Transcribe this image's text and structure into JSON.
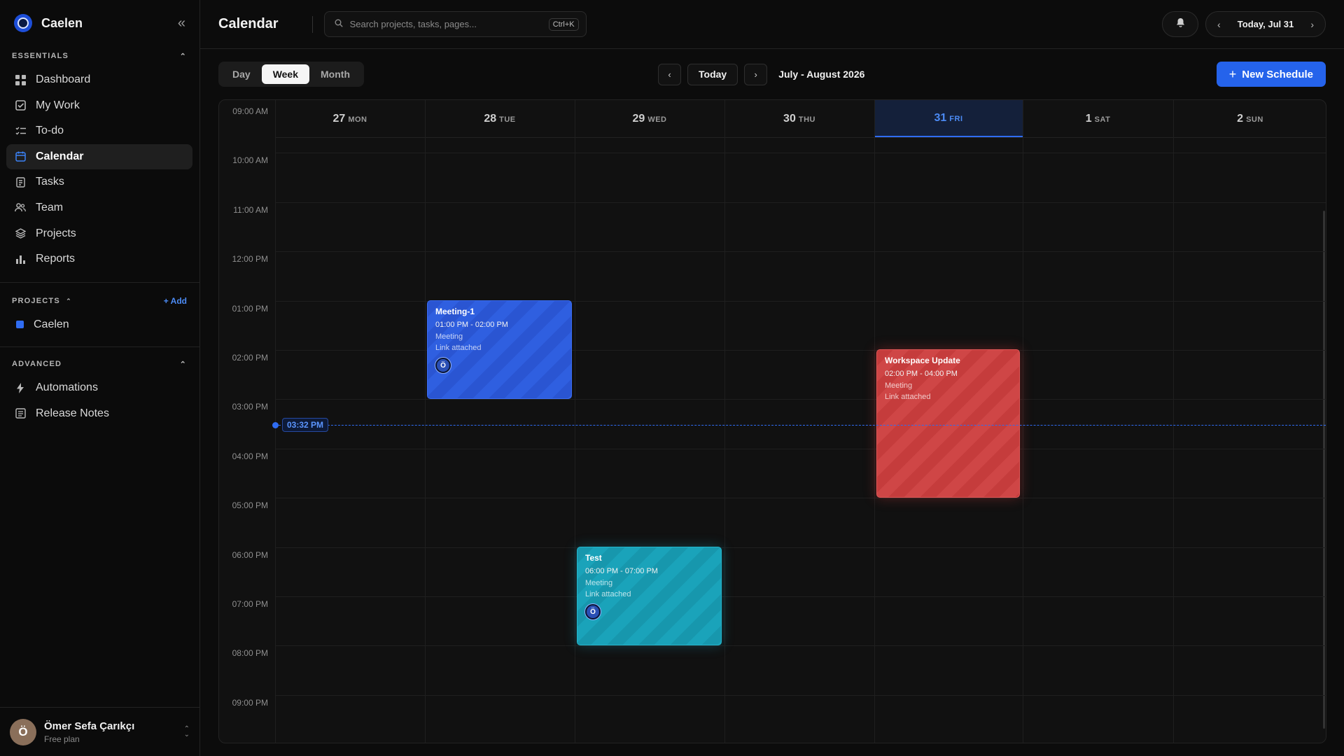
{
  "brand": {
    "name": "Caelen"
  },
  "sidebar": {
    "essentials_label": "ESSENTIALS",
    "items": [
      {
        "label": "Dashboard",
        "icon": "grid-icon"
      },
      {
        "label": "My Work",
        "icon": "checkbox-icon"
      },
      {
        "label": "To-do",
        "icon": "checklist-icon"
      },
      {
        "label": "Calendar",
        "icon": "calendar-icon",
        "active": true
      },
      {
        "label": "Tasks",
        "icon": "clipboard-icon"
      },
      {
        "label": "Team",
        "icon": "users-icon"
      },
      {
        "label": "Projects",
        "icon": "layers-icon"
      },
      {
        "label": "Reports",
        "icon": "bar-chart-icon"
      }
    ],
    "projects_label": "PROJECTS",
    "add_label": "+ Add",
    "projects": [
      {
        "label": "Caelen",
        "color": "#2f6cf2"
      }
    ],
    "advanced_label": "ADVANCED",
    "advanced_items": [
      {
        "label": "Automations",
        "icon": "bolt-icon"
      },
      {
        "label": "Release Notes",
        "icon": "notes-icon"
      }
    ]
  },
  "user": {
    "initial": "Ö",
    "name": "Ömer Sefa Çarıkçı",
    "plan": "Free plan"
  },
  "header": {
    "title": "Calendar",
    "search_placeholder": "Search projects, tasks, pages...",
    "search_shortcut": "Ctrl+K",
    "date_label": "Today, Jul 31"
  },
  "toolbar": {
    "views": [
      "Day",
      "Week",
      "Month"
    ],
    "active_view": "Week",
    "today_label": "Today",
    "range_label": "July - August 2026",
    "new_button": "New Schedule"
  },
  "calendar": {
    "days": [
      {
        "num": "27",
        "wd": "MON"
      },
      {
        "num": "28",
        "wd": "TUE"
      },
      {
        "num": "29",
        "wd": "WED"
      },
      {
        "num": "30",
        "wd": "THU"
      },
      {
        "num": "31",
        "wd": "FRI",
        "today": true
      },
      {
        "num": "1",
        "wd": "SAT"
      },
      {
        "num": "2",
        "wd": "SUN"
      }
    ],
    "hours": [
      "09:00 AM",
      "10:00 AM",
      "11:00 AM",
      "12:00 PM",
      "01:00 PM",
      "02:00 PM",
      "03:00 PM",
      "04:00 PM",
      "05:00 PM",
      "06:00 PM",
      "07:00 PM",
      "08:00 PM",
      "09:00 PM"
    ],
    "now_label": "03:32 PM",
    "events": [
      {
        "title": "Meeting-1",
        "time": "01:00 PM - 02:00 PM",
        "type": "Meeting",
        "link": "Link attached",
        "avatar": "Ö",
        "color": "blue"
      },
      {
        "title": "Workspace Update",
        "time": "02:00 PM - 04:00 PM",
        "type": "Meeting",
        "link": "Link attached",
        "color": "red"
      },
      {
        "title": "Test",
        "time": "06:00 PM - 07:00 PM",
        "type": "Meeting",
        "link": "Link attached",
        "avatar": "Ö",
        "color": "teal"
      }
    ]
  }
}
